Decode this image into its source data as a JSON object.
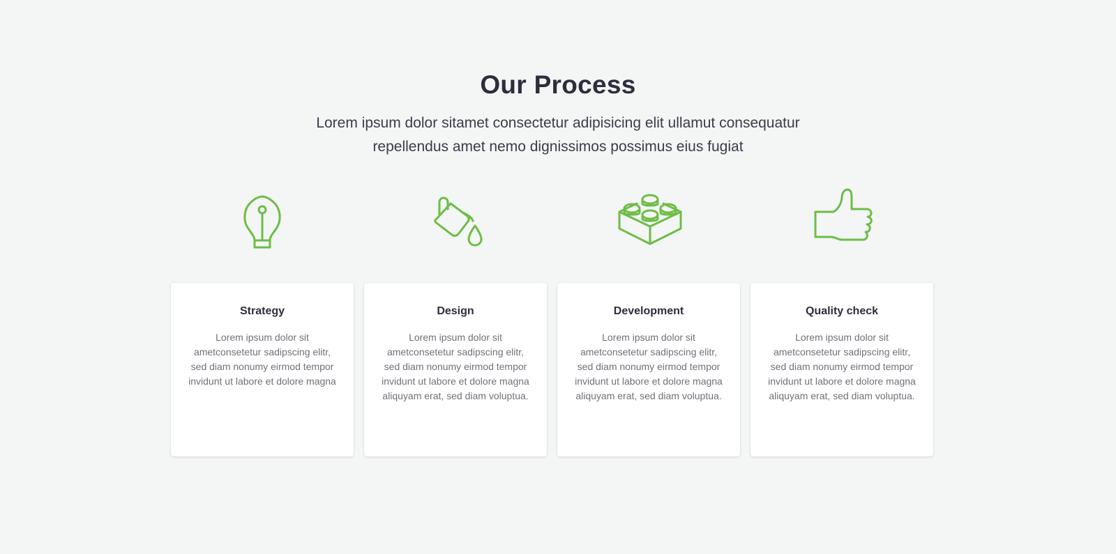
{
  "header": {
    "title": "Our Process",
    "subtitle_line1": "Lorem ipsum dolor sitamet consectetur adipisicing elit ullamut consequatur",
    "subtitle_line2": "repellendus amet nemo dignissimos possimus eius fugiat"
  },
  "accent_color": "#6cbd45",
  "steps": [
    {
      "icon": "lightbulb-icon",
      "title": "Strategy",
      "text": "Lorem ipsum dolor sit ametconsetetur sadipscing elitr, sed diam nonumy eirmod tempor invidunt ut labore et dolore magna"
    },
    {
      "icon": "paint-bucket-icon",
      "title": "Design",
      "text": "Lorem ipsum dolor sit ametconsetetur sadipscing elitr, sed diam nonumy eirmod tempor invidunt ut labore et dolore magna aliquyam erat, sed diam voluptua."
    },
    {
      "icon": "lego-brick-icon",
      "title": "Development",
      "text": "Lorem ipsum dolor sit ametconsetetur sadipscing elitr, sed diam nonumy eirmod tempor invidunt ut labore et dolore magna aliquyam erat, sed diam voluptua."
    },
    {
      "icon": "thumbs-up-icon",
      "title": "Quality check",
      "text": "Lorem ipsum dolor sit ametconsetetur sadipscing elitr, sed diam nonumy eirmod tempor invidunt ut labore et dolore magna aliquyam erat, sed diam voluptua."
    }
  ]
}
